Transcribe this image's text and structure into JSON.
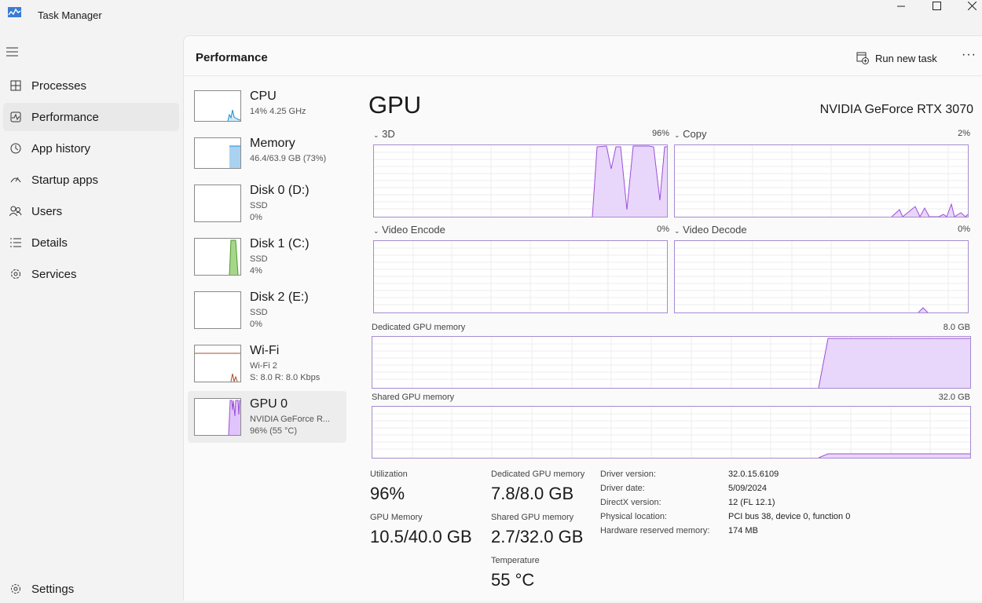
{
  "app": {
    "title": "Task Manager"
  },
  "nav": {
    "items": [
      {
        "label": "Processes",
        "icon": "processes-icon"
      },
      {
        "label": "Performance",
        "icon": "performance-icon"
      },
      {
        "label": "App history",
        "icon": "app-history-icon"
      },
      {
        "label": "Startup apps",
        "icon": "startup-icon"
      },
      {
        "label": "Users",
        "icon": "users-icon"
      },
      {
        "label": "Details",
        "icon": "details-icon"
      },
      {
        "label": "Services",
        "icon": "services-icon"
      }
    ],
    "settings": "Settings"
  },
  "header": {
    "title": "Performance",
    "run_task": "Run new task",
    "more": "···"
  },
  "devices": [
    {
      "name": "CPU",
      "l1": "14%  4.25 GHz",
      "l2": ""
    },
    {
      "name": "Memory",
      "l1": "46.4/63.9 GB (73%)",
      "l2": ""
    },
    {
      "name": "Disk 0 (D:)",
      "l1": "SSD",
      "l2": "0%"
    },
    {
      "name": "Disk 1 (C:)",
      "l1": "SSD",
      "l2": "4%"
    },
    {
      "name": "Disk 2 (E:)",
      "l1": "SSD",
      "l2": "0%"
    },
    {
      "name": "Wi-Fi",
      "l1": "Wi-Fi 2",
      "l2": "S: 8.0  R: 8.0 Kbps"
    },
    {
      "name": "GPU 0",
      "l1": "NVIDIA GeForce R...",
      "l2": "96%  (55 °C)"
    }
  ],
  "gpu": {
    "title": "GPU",
    "model": "NVIDIA GeForce RTX 3070",
    "graphs": {
      "g3d": {
        "label": "3D",
        "value": "96%"
      },
      "copy": {
        "label": "Copy",
        "value": "2%"
      },
      "encode": {
        "label": "Video Encode",
        "value": "0%"
      },
      "decode": {
        "label": "Video Decode",
        "value": "0%"
      },
      "dedicated": {
        "label": "Dedicated GPU memory",
        "value": "8.0 GB"
      },
      "shared": {
        "label": "Shared GPU memory",
        "value": "32.0 GB"
      }
    },
    "stats": {
      "utilization": {
        "label": "Utilization",
        "value": "96%"
      },
      "dedicated": {
        "label": "Dedicated GPU memory",
        "value": "7.8/8.0 GB"
      },
      "gpu_memory": {
        "label": "GPU Memory",
        "value": "10.5/40.0 GB"
      },
      "shared": {
        "label": "Shared GPU memory",
        "value": "2.7/32.0 GB"
      },
      "temperature": {
        "label": "Temperature",
        "value": "55 °C"
      }
    },
    "info": [
      {
        "k": "Driver version:",
        "v": "32.0.15.6109"
      },
      {
        "k": "Driver date:",
        "v": "5/09/2024"
      },
      {
        "k": "DirectX version:",
        "v": "12 (FL 12.1)"
      },
      {
        "k": "Physical location:",
        "v": "PCI bus 38, device 0, function 0"
      },
      {
        "k": "Hardware reserved memory:",
        "v": "174 MB"
      }
    ]
  },
  "colors": {
    "gpu_line": "#9b4fd8",
    "gpu_fill": "#e9d6fb",
    "cpu": "#1b8fd2",
    "memory": "#a9d2f1",
    "disk": "#4c9a2a",
    "wifi": "#a0522d"
  }
}
